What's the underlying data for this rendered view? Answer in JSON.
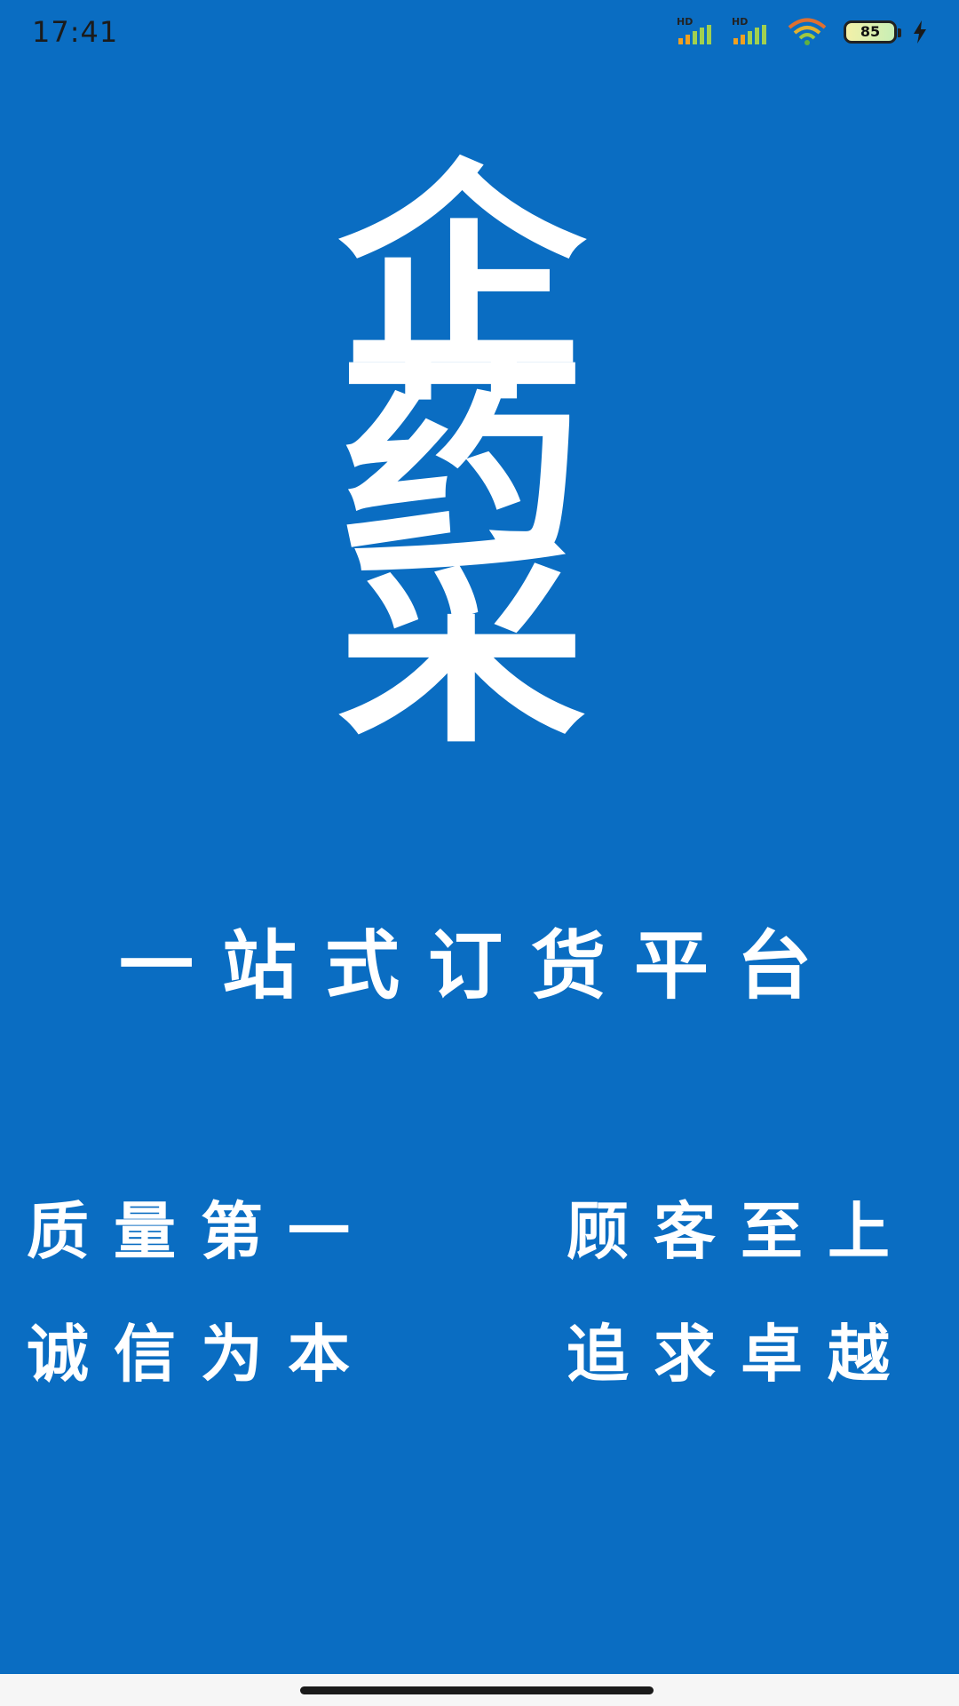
{
  "status_bar": {
    "time": "17:41",
    "sim1_label": "HD",
    "sim2_label": "HD",
    "battery_level": "85",
    "icons": [
      "signal-icon",
      "signal-icon",
      "wifi-icon",
      "battery-icon",
      "charging-icon"
    ]
  },
  "logo": {
    "chars": [
      "企",
      "药",
      "采"
    ]
  },
  "slogan": "一站式订货平台",
  "mottos": {
    "row1_left": "质量第一",
    "row1_right": "顾客至上",
    "row2_left": "诚信为本",
    "row2_right": "追求卓越"
  },
  "colors": {
    "background": "#0a6dc2",
    "text": "#ffffff",
    "nav_bar": "#f6f6f6"
  }
}
